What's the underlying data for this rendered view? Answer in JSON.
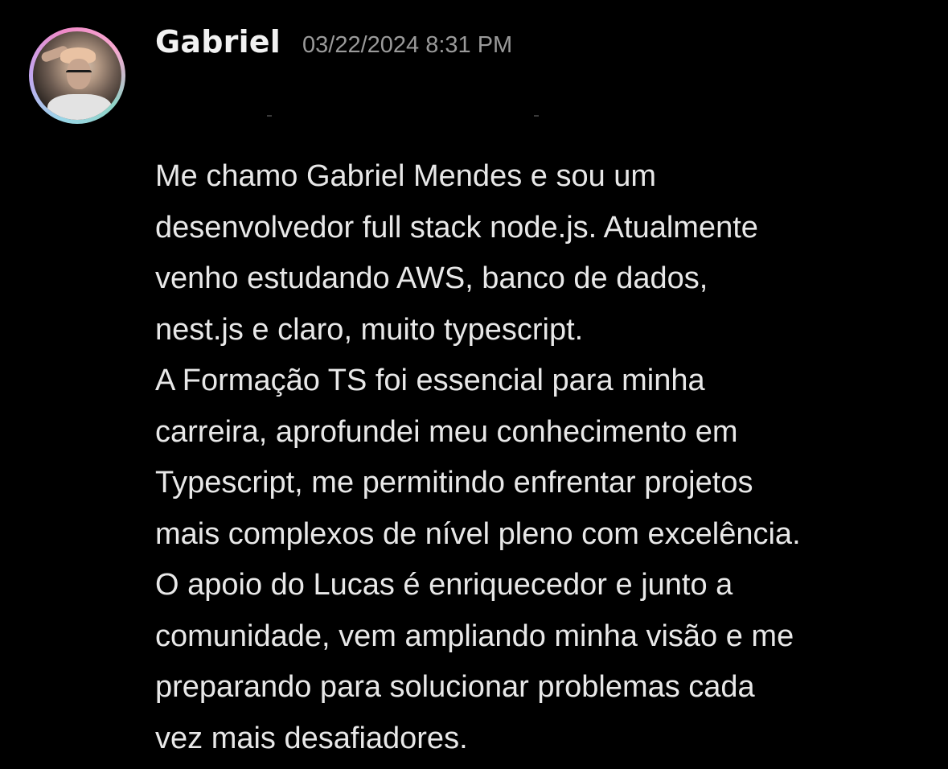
{
  "message": {
    "author": "Gabriel",
    "timestamp": "03/22/2024 8:31 PM",
    "avatar_icon": "user-avatar-photo",
    "lines": [
      "Me chamo Gabriel Mendes e sou um",
      "desenvolvedor full stack node.js. Atualmente",
      "venho estudando AWS, banco de dados,",
      "nest.js e claro, muito typescript.",
      "A Formação TS foi essencial para minha",
      "carreira, aprofundei meu conhecimento em",
      "Typescript, me permitindo enfrentar projetos",
      "mais complexos de nível pleno com excelência.",
      "O apoio do Lucas é enriquecedor e junto a",
      "comunidade, vem ampliando minha visão e me",
      "preparando para solucionar problemas cada",
      "vez mais desafiadores."
    ]
  },
  "colors": {
    "background": "#000000",
    "author": "#f2f2f2",
    "timestamp": "#9a9a9a",
    "text": "#e8e8e8"
  }
}
